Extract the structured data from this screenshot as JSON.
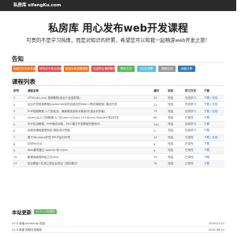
{
  "header": {
    "logo": "私房库 sifangKu.com"
  },
  "hero": {
    "title": "私房库 用心发布web开发课程",
    "subtitle": "可贵的不是学习热情，而是对知识的积累，希望您可以和我一起畅游web开发之旅！"
  },
  "notice": {
    "title": "告知",
    "buttons": [
      {
        "label": "网站已针对IE升级",
        "color": "#e8762d"
      },
      {
        "label": "请勿用于商业用途",
        "color": "#d9534f"
      },
      {
        "label": "欢迎大家投稿课程",
        "color": "#e8762d"
      },
      {
        "label": "欢迎提出课程需求",
        "color": "#d9534f"
      },
      {
        "label": "联系方式",
        "color": "#5cb85c"
      },
      {
        "label": "QQ交流群",
        "color": "#5bc0de"
      },
      {
        "label": "视频交流",
        "color": "#999999"
      },
      {
        "label": "网盘分享",
        "color": "#337ab7"
      }
    ]
  },
  "course_list": {
    "title": "课程列表",
    "columns": [
      "序号",
      "课程名称",
      "课时",
      "状态",
      "学习方式",
      "下载"
    ],
    "rows": [
      [
        "1",
        "HTML(div,css) 视频教程(适合于走进前端)",
        "32",
        "完结",
        "在线学习",
        "下载 | 在线"
      ],
      [
        "2",
        "后台开发框架教程(javascript实现自适应的Web UI的前端框架) 建站开发",
        "21",
        "完结",
        "在线学习",
        "下载 | 在线"
      ],
      [
        "3",
        "PHP视频教程-入门到实战，最新增加面向对象部分(适合初学者)",
        "73",
        "完结",
        "在线学习",
        "下载 | 在线"
      ],
      [
        "4",
        "jQuery从入门到精通-入门jQuery+jQuery UI+jQuery Mobile+项目开发",
        "60",
        "完结",
        "已录完",
        "下载"
      ],
      [
        "5",
        "PHP实战教程，PHP面向对象，MVC模式开发教程完整系列",
        "144",
        "完结",
        "在线学习",
        "下载"
      ],
      [
        "6",
        "私房库课程管理系统 原型设计思路",
        "3",
        "完结",
        "在线学习",
        "下载"
      ],
      [
        "7",
        "基于Windows环境下PHP运行环境",
        "12",
        "完结",
        "已录完",
        "下载 | 在线"
      ],
      [
        "8",
        "初识MySQL",
        "6",
        "完结",
        "已录完",
        "下载"
      ],
      [
        "9",
        "Web服务器之 apache 和 nginx",
        "9",
        "完结",
        "已录完",
        "下载"
      ],
      [
        "10",
        "数据库管理系统之MySQL",
        "15",
        "完结",
        "已录完",
        "下载"
      ],
      [
        "11",
        "结合模板+实用之前后台项目（团队模式）",
        "18",
        "完结",
        "已录完",
        "下载"
      ]
    ]
  },
  "updates": {
    "title": "本站更新",
    "badge": "V3.0 +7天更新",
    "items": [
      {
        "text": "V3.0 新增 bootstrap 框架",
        "date": "2016-01-07"
      },
      {
        "text": "V2.0 新增 视频在线播放",
        "date": "2015-08-14"
      }
    ]
  },
  "watermark": {
    "text": "链发发SEO"
  }
}
